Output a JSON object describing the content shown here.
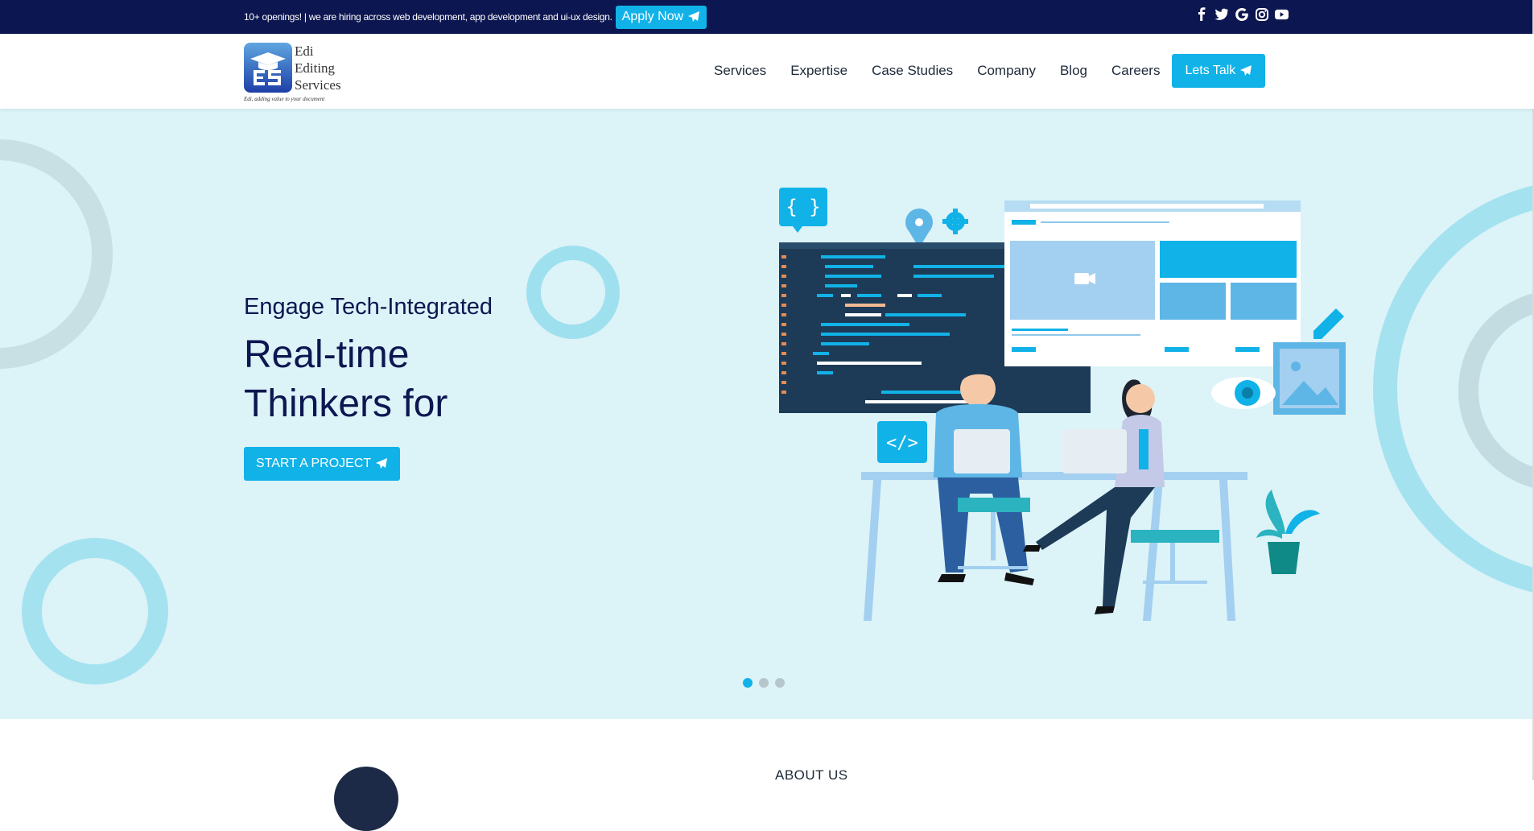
{
  "topbar": {
    "message": "10+ openings! | we are hiring across web development, app development and ui-ux design.",
    "apply_label": "Apply Now",
    "socials": [
      "facebook-icon",
      "twitter-icon",
      "google-icon",
      "instagram-icon",
      "youtube-icon"
    ]
  },
  "header": {
    "logo_name": "Edi Editing Services",
    "logo_line1": "Edi",
    "logo_line2": "Editing",
    "logo_line3": "Services",
    "logo_tagline": "Edi, adding value to your document",
    "nav": [
      "Services",
      "Expertise",
      "Case Studies",
      "Company",
      "Blog",
      "Careers"
    ],
    "cta_label": "Lets Talk"
  },
  "hero": {
    "subtitle": "Engage Tech-Integrated",
    "title": "Real-time Thinkers for",
    "button_label": "START A PROJECT",
    "slides": 3,
    "active_slide": 1
  },
  "about": {
    "label": "ABOUT US"
  },
  "colors": {
    "navy": "#0c1650",
    "accent": "#11b2e8",
    "hero_bg": "#dcf3f8"
  }
}
